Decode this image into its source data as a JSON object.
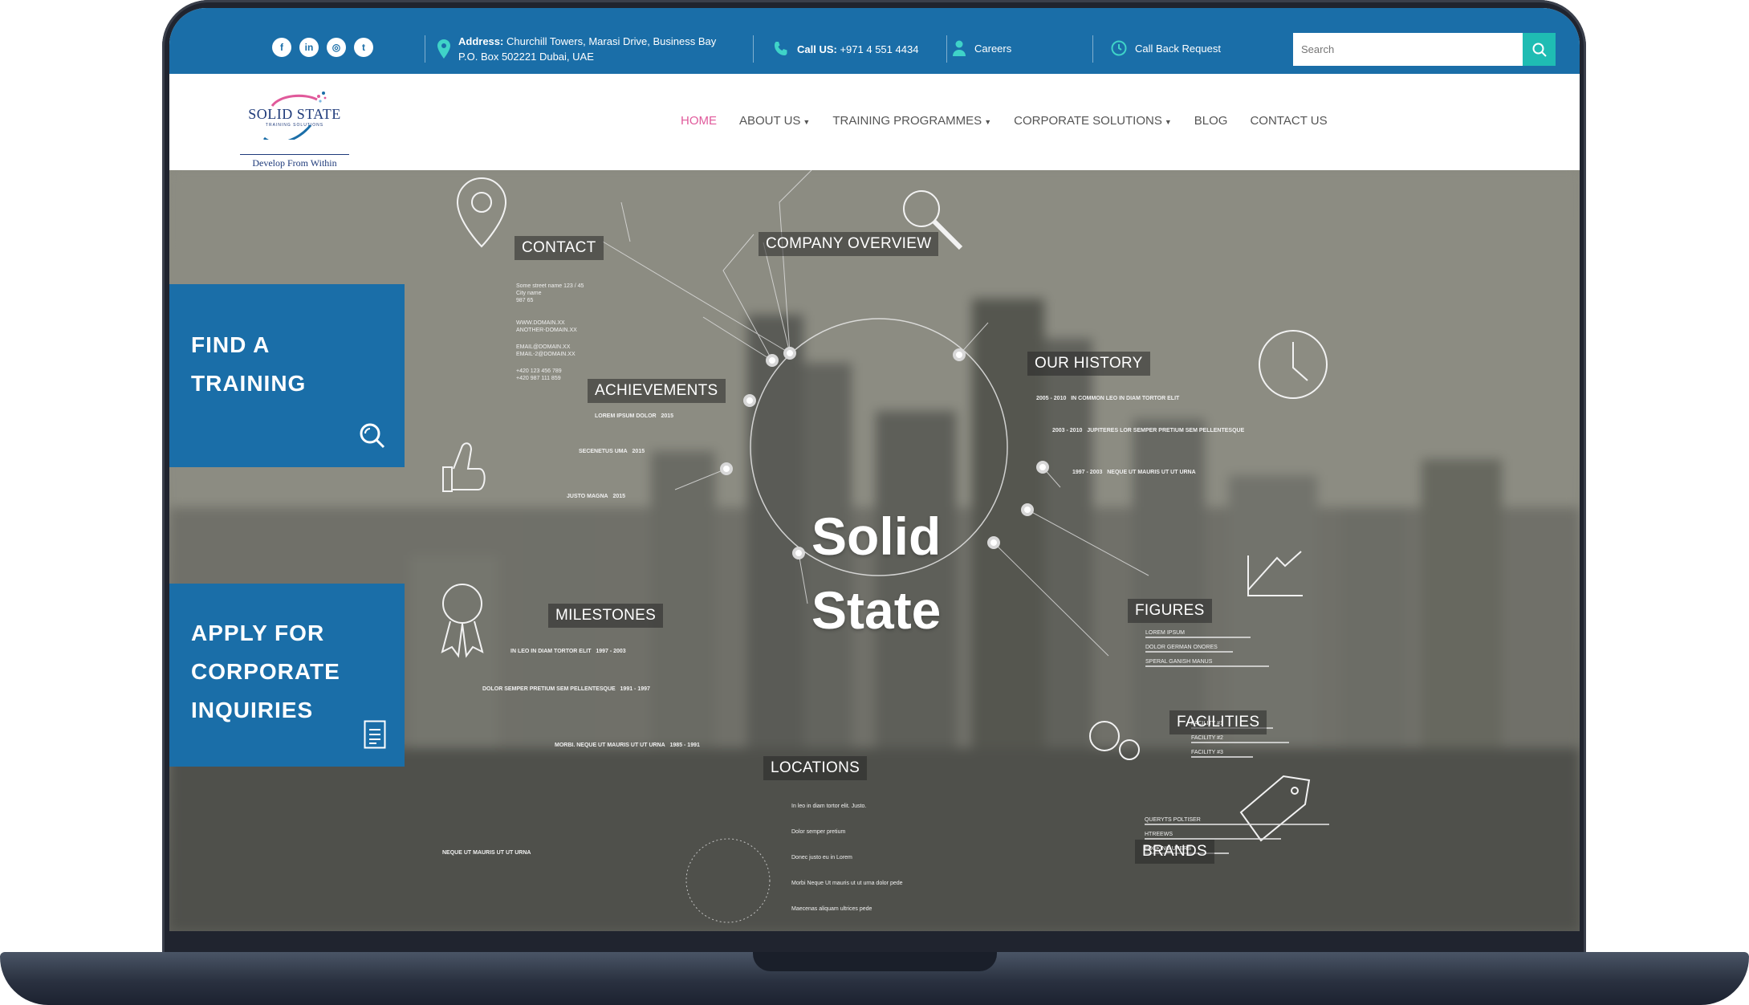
{
  "topbar": {
    "socials": [
      {
        "icon": "facebook-icon",
        "glyph": "f"
      },
      {
        "icon": "linkedin-icon",
        "glyph": "in"
      },
      {
        "icon": "instagram-icon",
        "glyph": "◎"
      },
      {
        "icon": "twitter-icon",
        "glyph": "t"
      }
    ],
    "address_label": "Address:",
    "address_line1": "Churchill Towers, Marasi Drive, Business Bay",
    "address_line2": "P.O. Box 502221 Dubai, UAE",
    "call_label": "Call US:",
    "call_number": "+971 4 551 4434",
    "careers": "Careers",
    "callback": "Call Back Request",
    "search_placeholder": "Search",
    "accent": "#1fbcb3",
    "bar_color": "#1a6ea8"
  },
  "logo": {
    "name": "SOLID STATE",
    "sub": "TRAINING SOLUTIONS",
    "tagline": "Develop From Within"
  },
  "nav": {
    "items": [
      {
        "label": "HOME",
        "active": true,
        "caret": false
      },
      {
        "label": "ABOUT US",
        "active": false,
        "caret": true
      },
      {
        "label": "TRAINING PROGRAMMES",
        "active": false,
        "caret": true
      },
      {
        "label": "CORPORATE SOLUTIONS",
        "active": false,
        "caret": true
      },
      {
        "label": "BLOG",
        "active": false,
        "caret": false
      },
      {
        "label": "CONTACT US",
        "active": false,
        "caret": false
      }
    ],
    "active_color": "#e05a9b"
  },
  "hero": {
    "title_line1": "Solid",
    "title_line2": "State",
    "cta_training": [
      "FIND A",
      "TRAINING"
    ],
    "cta_corporate": [
      "APPLY FOR",
      "CORPORATE",
      "INQUIRIES"
    ],
    "labels": {
      "contact": "CONTACT",
      "company": "COMPANY OVERVIEW",
      "history": "OUR HISTORY",
      "achievements": "ACHIEVEMENTS",
      "milestones": "MILESTONES",
      "figures": "FIGURES",
      "facilities": "FACILITIES",
      "locations": "LOCATIONS",
      "brands": "BRANDS"
    },
    "contact_lines": [
      "Some street name 123 / 45",
      "City name",
      "987 65",
      "WWW.DOMAIN.XX",
      "ANOTHER-DOMAIN.XX",
      "EMAIL@DOMAIN.XX",
      "EMAIL-2@DOMAIN.XX",
      "+420 123 456 789",
      "+420 987 111 859"
    ],
    "history_items": [
      "2005 - 2010",
      "IN COMMON LEO IN DIAM TORTOR ELIT",
      "2003 - 2010",
      "JUPITERES LOR SEMPER PRETIUM SEM PELLENTESQUE",
      "1997 - 2003",
      "NEQUE UT MAURIS UT UT URNA"
    ],
    "achievement_items": [
      "LOREM IPSUM DOLOR",
      "2015",
      "SECENETUS UMA",
      "2015",
      "JUSTO MAGNA",
      "2015"
    ],
    "milestone_items": [
      "IN LEO IN DIAM TORTOR ELIT",
      "1997 - 2003",
      "DOLOR SEMPER PRETIUM SEM PELLENTESQUE",
      "1991 - 1997",
      "MORBI. NEQUE UT MAURIS UT UT URNA",
      "1985 - 1991"
    ],
    "figure_items": [
      "LOREM IPSUM",
      "DOLOR GERMAN ONORES",
      "SPERAL GANISH MANUS"
    ],
    "facility_items": [
      "FACILITY #1",
      "FACILITY #2",
      "FACILITY #3"
    ],
    "brand_items": [
      "QUERYTS POLTISER",
      "HTREEWS",
      "FOCKING UPERS"
    ],
    "location_items": [
      "In leo in diam tortor elit. Justo.",
      "Dolor semper pretium",
      "Donec justo eu in Lorem",
      "Morbi Neque Ut mauris ut ut urna dolor pede",
      "Maecenas aliquam ultrices pede"
    ],
    "neque_heading": "NEQUE UT MAURIS UT UT URNA"
  }
}
